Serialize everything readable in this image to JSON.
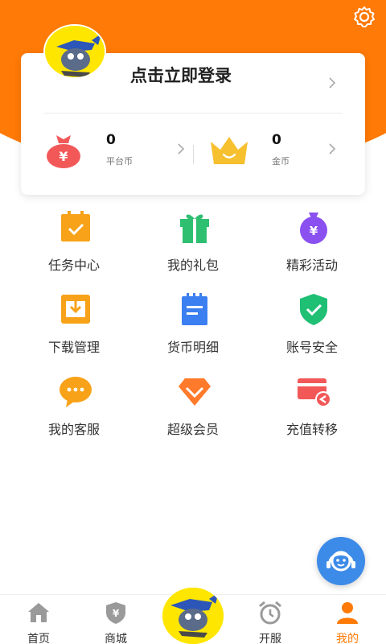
{
  "header": {
    "settings_icon": "gear-icon",
    "accent": "#ff7a06"
  },
  "profile": {
    "login_label": "点击立即登录",
    "avatar_icon": "mascot-avatar"
  },
  "wallet": {
    "platform_coin": {
      "value": "0",
      "label": "平台币",
      "icon": "money-bag-icon",
      "color": "#f25858"
    },
    "gold_coin": {
      "value": "0",
      "label": "金币",
      "icon": "crown-icon",
      "color": "#f7c02f"
    }
  },
  "menu": [
    {
      "label": "任务中心",
      "icon": "task-clipboard-icon",
      "color": "#f8a219"
    },
    {
      "label": "我的礼包",
      "icon": "gift-icon",
      "color": "#2fbf71"
    },
    {
      "label": "精彩活动",
      "icon": "yen-bag-icon",
      "color": "#8a50f0"
    },
    {
      "label": "下载管理",
      "icon": "download-box-icon",
      "color": "#f8a219"
    },
    {
      "label": "货币明细",
      "icon": "notepad-icon",
      "color": "#3c7ff0"
    },
    {
      "label": "账号安全",
      "icon": "shield-check-icon",
      "color": "#1fbf74"
    },
    {
      "label": "我的客服",
      "icon": "chat-bubble-icon",
      "color": "#f8a219"
    },
    {
      "label": "超级会员",
      "icon": "diamond-icon",
      "color": "#ff7a2a"
    },
    {
      "label": "充值转移",
      "icon": "card-transfer-icon",
      "color": "#f25858"
    }
  ],
  "fab": {
    "icon": "customer-service-icon",
    "color": "#3d8be8"
  },
  "tabs": [
    {
      "label": "首页",
      "icon": "home-icon"
    },
    {
      "label": "商城",
      "icon": "shop-shield-icon"
    },
    {
      "label": "",
      "icon": "mascot-center-icon"
    },
    {
      "label": "开服",
      "icon": "alarm-clock-icon"
    },
    {
      "label": "我的",
      "icon": "person-icon",
      "active": true
    }
  ]
}
